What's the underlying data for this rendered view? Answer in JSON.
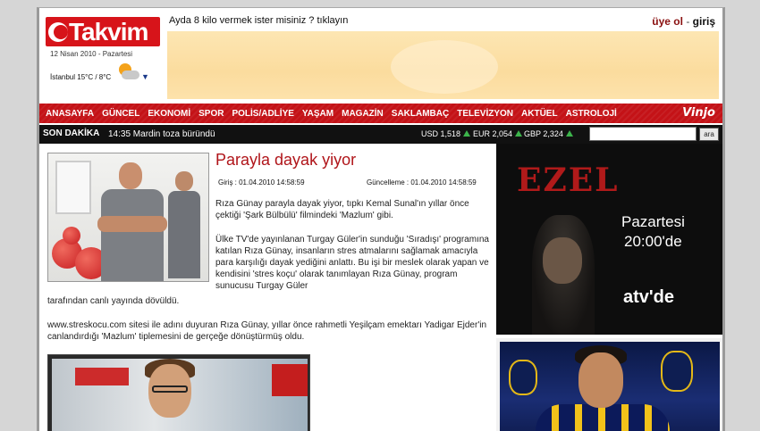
{
  "header": {
    "logo_text": "Takvim",
    "date": "12 Nisan 2010 - Pazartesi",
    "weather": "İstanbul 15°C / 8°C",
    "promo": "Ayda 8 kilo vermek ister misiniz ? tıklayın",
    "login_register": "üye ol",
    "login_sep": " - ",
    "login_signin": "giriş"
  },
  "nav": {
    "items": [
      "ANASAYFA",
      "GÜNCEL",
      "EKONOMİ",
      "SPOR",
      "POLİS/ADLİYE",
      "YAŞAM",
      "MAGAZİN",
      "SAKLAMBAÇ",
      "TELEVİZYON",
      "AKTÜEL",
      "ASTROLOJİ"
    ],
    "brand": "Vinjo"
  },
  "ticker": {
    "label": "SON DAKİKA",
    "news": "14:35 Mardin toza büründü",
    "usd": "USD 1,518",
    "eur": "EUR 2,054",
    "gbp": "GBP 2,324",
    "search_button": "ara",
    "search_value": ""
  },
  "article": {
    "title": "Parayla dayak yiyor",
    "entry": "Giriş : 01.04.2010 14:58:59",
    "updated": "Güncelleme : 01.04.2010 14:58:59",
    "p1": "Rıza Günay parayla dayak yiyor, tıpkı Kemal Sunal'ın yıllar önce çektiği 'Şark Bülbülü' filmindeki 'Mazlum' gibi.",
    "p2a": "Ülke TV'de yayınlanan Turgay Güler'in sunduğu 'Sıradışı' programına katılan Rıza Günay, insanların stres atmalarını sağlamak amacıyla para karşılığı dayak yediğini anlattı. Bu işi bir meslek olarak yapan ve kendisini 'stres koçu' olarak tanımlayan Rıza Günay, program sunucusu Turgay Güler",
    "p2b": "tarafından canlı yayında dövüldü.",
    "p3": "www.streskocu.com sitesi ile adını duyuran Rıza Günay, yıllar önce rahmetli Yeşilçam emektarı Yadigar Ejder'in canlandırdığı 'Mazlum' tiplemesini de gerçeğe dönüştürmüş oldu."
  },
  "ads": {
    "ad1_title": "EZEL",
    "ad1_day": "Pazartesi",
    "ad1_time": "20:00'de",
    "ad1_channel": "atv'de"
  },
  "colors": {
    "brand_red": "#c41217",
    "title_red": "#b0151a",
    "up_green": "#3cb44b"
  }
}
